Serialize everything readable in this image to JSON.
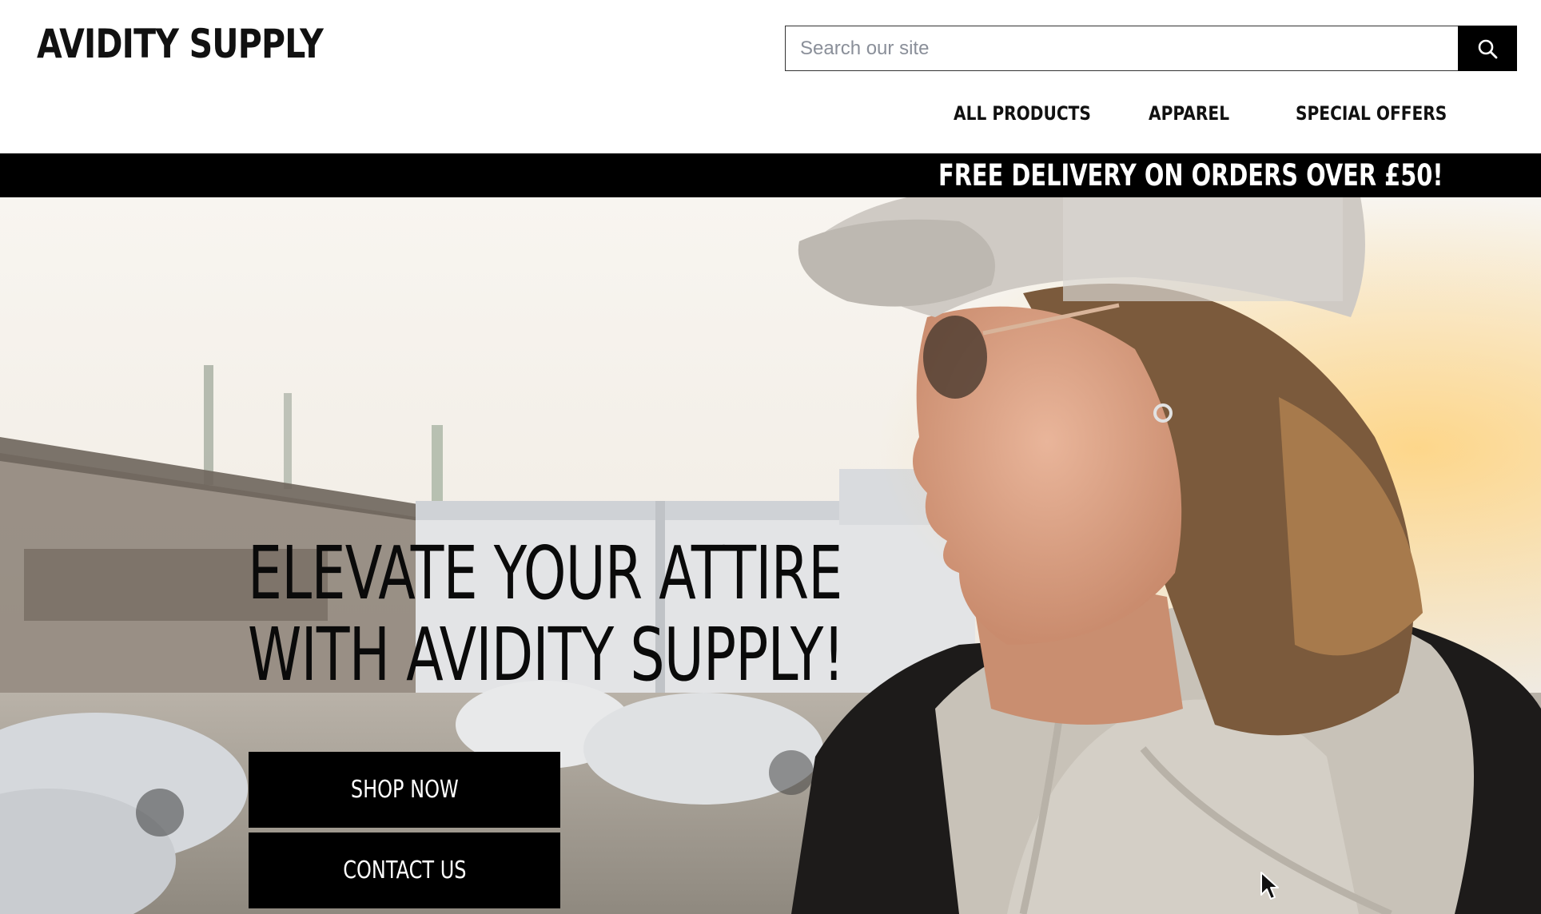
{
  "header": {
    "logo": "AVIDITY SUPPLY",
    "search": {
      "placeholder": "Search our site",
      "value": "",
      "button_icon": "search-icon"
    },
    "nav": [
      {
        "label": "ALL PRODUCTS"
      },
      {
        "label": "APPAREL"
      },
      {
        "label": "SPECIAL OFFERS"
      }
    ]
  },
  "promo_bar": {
    "text": "FREE DELIVERY ON ORDERS OVER £50!"
  },
  "hero": {
    "title": "ELEVATE YOUR ATTIRE WITH AVIDITY SUPPLY!",
    "buttons": {
      "shop_now": "SHOP NOW",
      "contact_us": "CONTACT US"
    }
  },
  "colors": {
    "background": "#ffffff",
    "primary": "#000000",
    "button_text": "#ffffff",
    "placeholder": "#8a8f99"
  }
}
